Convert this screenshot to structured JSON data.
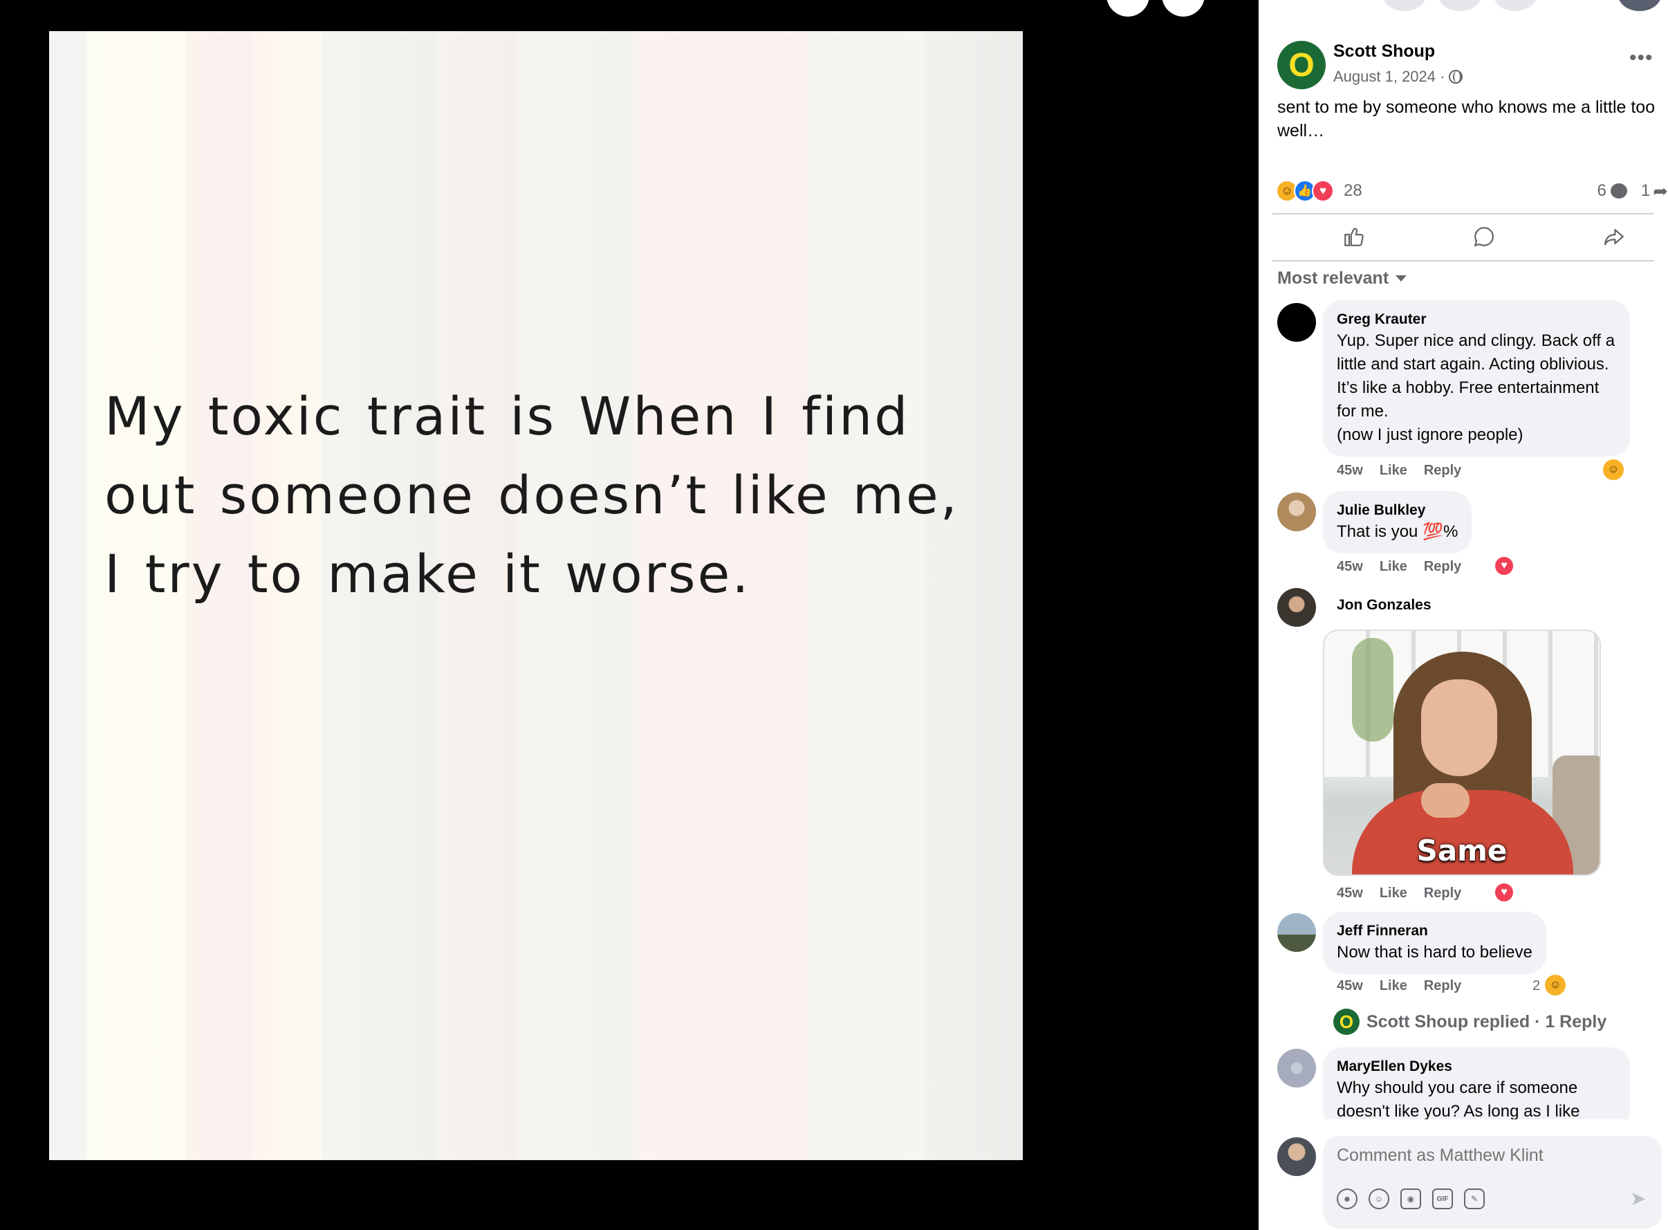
{
  "photo": {
    "text": "My toxic trait is When I find out someone doesn’t like me, I try to make it worse."
  },
  "post": {
    "author": "Scott Shoup",
    "avatar_letter": "O",
    "date": "August 1, 2024 ·",
    "caption": "sent to me by someone who knows me a little too well…",
    "reaction_count": "28",
    "comment_count": "6",
    "share_count": "1",
    "sort_label": "Most relevant"
  },
  "comments": [
    {
      "name": "Greg Krauter",
      "text": "Yup. Super nice and clingy. Back off a little and start again. Acting oblivious. It’s like a hobby. Free entertainment for me.\n(now I just ignore people)",
      "time": "45w",
      "like": "Like",
      "reply": "Reply"
    },
    {
      "name": "Julie Bulkley",
      "text": "That is you 💯%",
      "time": "45w",
      "like": "Like",
      "reply": "Reply"
    },
    {
      "name": "Jon Gonzales",
      "gif_caption": "Same",
      "time": "45w",
      "like": "Like",
      "reply": "Reply"
    },
    {
      "name": "Jeff Finneran",
      "text": "Now that is hard to believe",
      "time": "45w",
      "like": "Like",
      "reply": "Reply",
      "reaction_count": "2"
    },
    {
      "name": "MaryEllen Dykes",
      "text": "Why should you care if someone doesn't like you? As long as I like"
    }
  ],
  "thread": {
    "avatar_letter": "O",
    "label": "Scott Shoup replied · 1 Reply"
  },
  "composer": {
    "placeholder": "Comment as Matthew Klint",
    "gif_label": "GIF"
  },
  "colors": {
    "oregon_green": "#1b6a35",
    "oregon_yellow": "#fee123",
    "bubble": "#f0f2f5",
    "secondary_text": "#65676b"
  },
  "icons": [
    "search-icon",
    "zoom-icon",
    "globe-icon",
    "more-icon",
    "like-icon",
    "comment-icon",
    "share-icon",
    "dropdown-icon",
    "heart-icon",
    "haha-icon",
    "avatar-icon",
    "emoji-icon",
    "camera-icon",
    "gif-icon",
    "sticker-icon",
    "send-icon"
  ]
}
